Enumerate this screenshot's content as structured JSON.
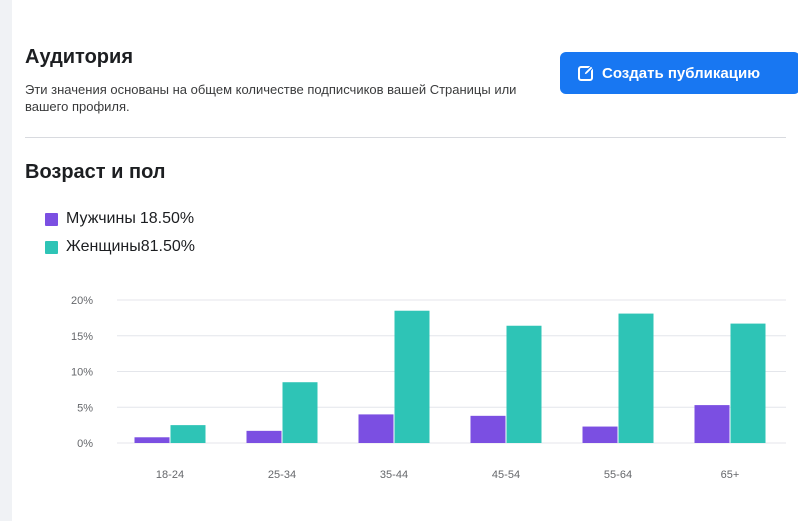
{
  "header": {
    "title": "Аудитория",
    "description": "Эти значения основаны на общем количестве подписчиков вашей Страницы или вашего профиля.",
    "create_button_label": "Создать публикацию"
  },
  "section": {
    "title": "Возраст и пол"
  },
  "colors": {
    "male": "#7b4fe2",
    "female": "#2ec4b6",
    "accent": "#1877f2"
  },
  "icons": {
    "create_button": "edit-icon"
  },
  "legend": [
    {
      "label": "Мужчины",
      "value": "18.50%"
    },
    {
      "label": "Женщины",
      "value": "81.50%"
    }
  ],
  "chart_data": {
    "type": "bar",
    "categories": [
      "18-24",
      "25-34",
      "35-44",
      "45-54",
      "55-64",
      "65+"
    ],
    "series": [
      {
        "name": "Мужчины",
        "values": [
          0.8,
          1.7,
          4.0,
          3.8,
          2.3,
          5.3
        ]
      },
      {
        "name": "Женщины",
        "values": [
          2.5,
          8.5,
          18.5,
          16.4,
          18.1,
          16.7
        ]
      }
    ],
    "yticks": [
      "0%",
      "5%",
      "10%",
      "15%",
      "20%"
    ],
    "ylim": [
      0,
      20
    ],
    "grid": true,
    "legend_position": "top-left"
  }
}
